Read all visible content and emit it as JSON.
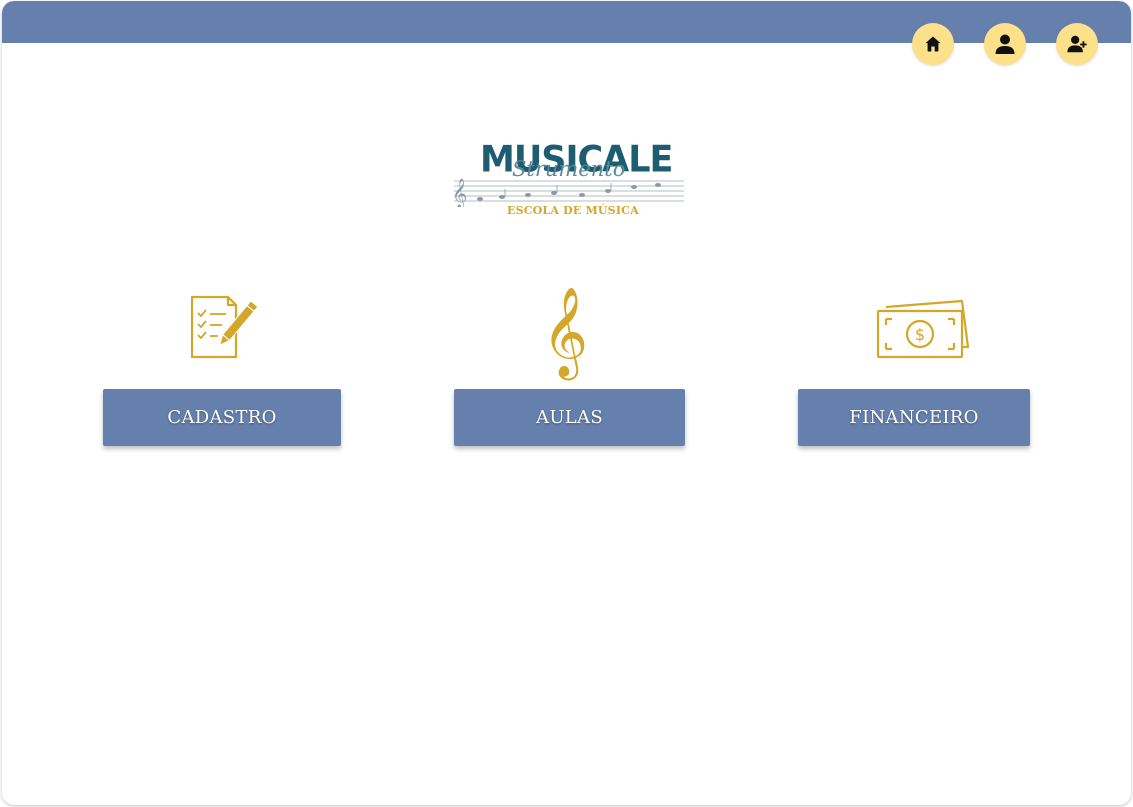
{
  "colors": {
    "topbar": "#6580ad",
    "button": "#6580ad",
    "nav_circle": "#fde08a",
    "gold_icon": "#d4a62a",
    "logo_primary": "#1d5d72"
  },
  "nav": [
    {
      "icon": "home-icon"
    },
    {
      "icon": "user-icon"
    },
    {
      "icon": "user-plus-icon"
    }
  ],
  "logo": {
    "title": "MUSICALE",
    "script": "Strumento",
    "subtitle": "ESCOLA DE MÚSICA"
  },
  "menu": [
    {
      "icon": "checklist-pencil-icon",
      "label": "CADASTRO"
    },
    {
      "icon": "treble-clef-icon",
      "label": "AULAS"
    },
    {
      "icon": "money-icon",
      "label": "FINANCEIRO"
    }
  ]
}
